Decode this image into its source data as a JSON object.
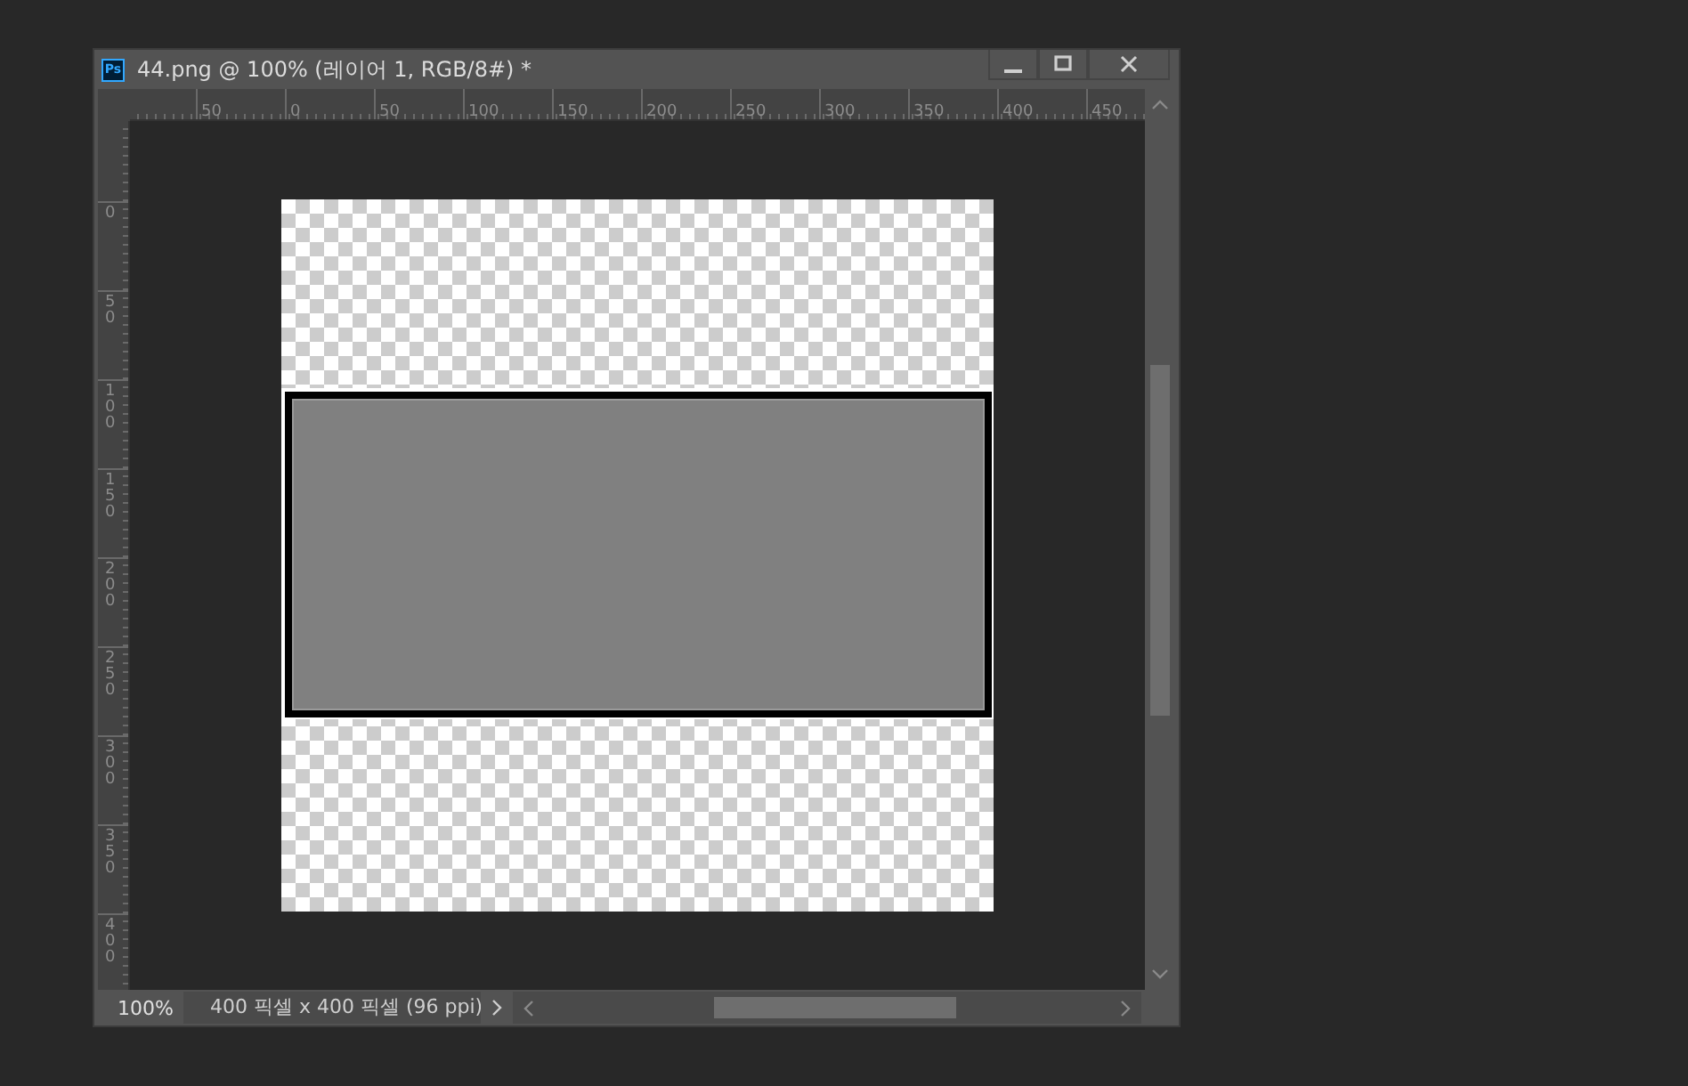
{
  "window": {
    "app_icon": "Ps",
    "title": "44.png @ 100% (레이어 1, RGB/8#) *"
  },
  "rulers": {
    "horizontal": [
      "50",
      "0",
      "50",
      "100",
      "150",
      "200",
      "250",
      "300",
      "350",
      "400",
      "450"
    ],
    "vertical": [
      "0",
      "50",
      "100",
      "150",
      "200",
      "250",
      "300",
      "350",
      "400"
    ]
  },
  "status_bar": {
    "zoom": "100%",
    "document_info": "400 픽셀 x 400 픽셀 (96 ppi)"
  }
}
